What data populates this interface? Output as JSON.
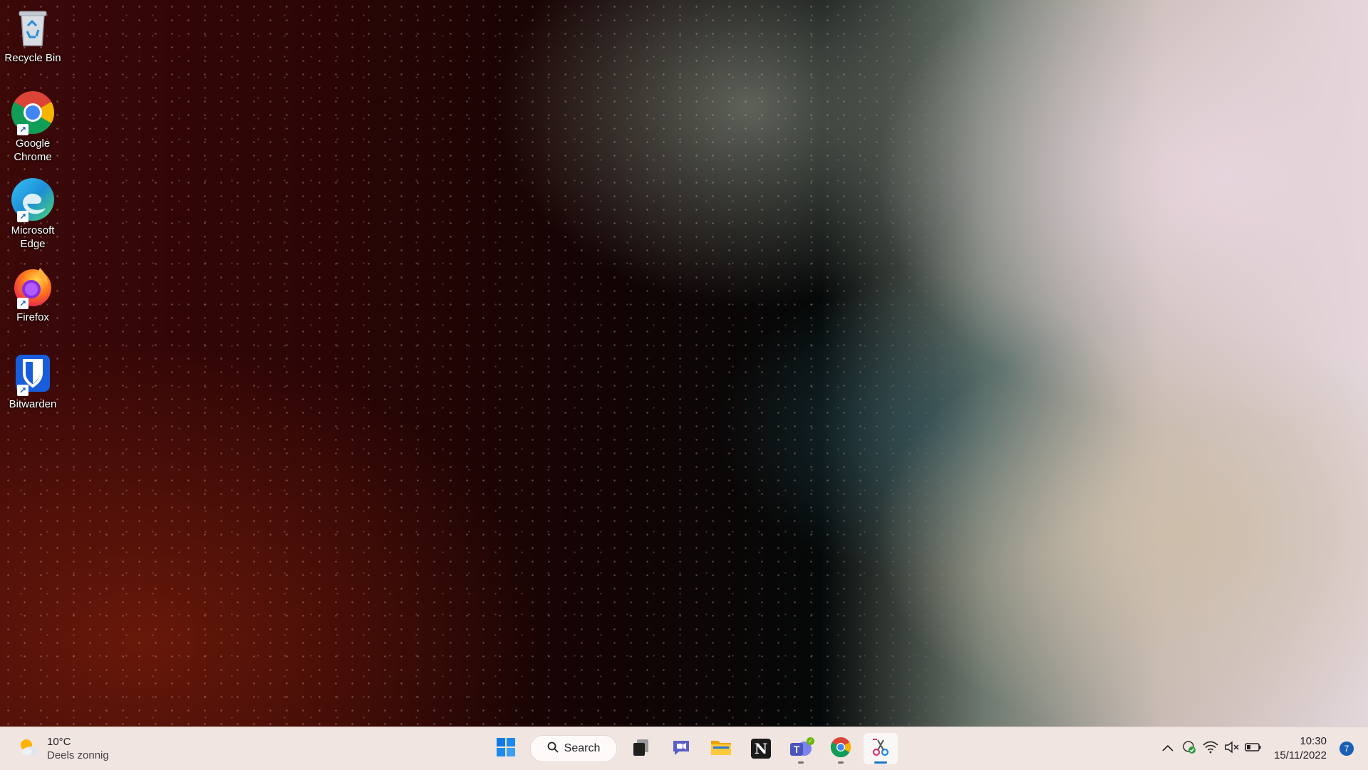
{
  "desktop": {
    "icons": [
      {
        "label": "Recycle Bin",
        "icon": "recycle-bin-icon"
      },
      {
        "label": "Google Chrome",
        "icon": "chrome-icon"
      },
      {
        "label": "Microsoft Edge",
        "icon": "edge-icon"
      },
      {
        "label": "Firefox",
        "icon": "firefox-icon"
      },
      {
        "label": "Bitwarden",
        "icon": "bitwarden-icon"
      }
    ]
  },
  "taskbar": {
    "weather": {
      "temperature": "10°C",
      "condition": "Deels zonnig",
      "icon": "partly-sunny-icon"
    },
    "search": {
      "label": "Search"
    },
    "apps": [
      {
        "name": "start",
        "icon": "windows-start-icon"
      },
      {
        "name": "task-view",
        "icon": "task-view-icon"
      },
      {
        "name": "teams-chat",
        "icon": "chat-icon"
      },
      {
        "name": "file-explorer",
        "icon": "folder-icon"
      },
      {
        "name": "notion",
        "icon": "notion-icon",
        "glyph": "N"
      },
      {
        "name": "teams",
        "icon": "teams-icon",
        "glyph": "T",
        "running": true
      },
      {
        "name": "chrome",
        "icon": "chrome-icon",
        "running": true
      },
      {
        "name": "snipping-tool",
        "icon": "snipping-tool-icon",
        "active": true
      }
    ],
    "tray": {
      "icons": [
        "chevron-up-icon",
        "update-check-icon",
        "wifi-icon",
        "volume-muted-icon",
        "battery-icon"
      ],
      "time": "10:30",
      "date": "15/11/2022",
      "notification_count": "7"
    }
  },
  "colors": {
    "taskbar_bg": "#f1e5e2",
    "accent": "#1a73c9",
    "chrome_red": "#db4437",
    "chrome_yellow": "#f4b400",
    "chrome_green": "#0f9d58",
    "chrome_blue": "#4285f4"
  }
}
